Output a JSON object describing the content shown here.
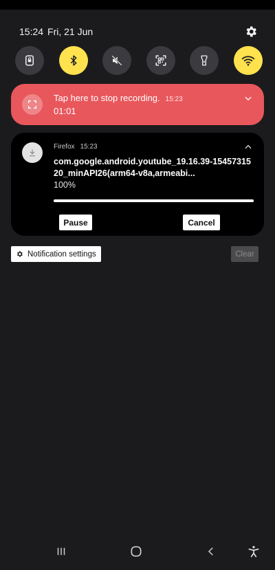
{
  "status": {
    "time": "15:24",
    "date": "Fri, 21 Jun"
  },
  "quick_settings": [
    {
      "name": "lock-screen-icon",
      "on": false
    },
    {
      "name": "bluetooth-icon",
      "on": true
    },
    {
      "name": "mute-icon",
      "on": false
    },
    {
      "name": "qr-scanner-icon",
      "on": false
    },
    {
      "name": "flashlight-icon",
      "on": false
    },
    {
      "name": "wifi-icon",
      "on": true
    }
  ],
  "recording": {
    "title": "Tap here to stop recording.",
    "time": "15:23",
    "elapsed": "01:01"
  },
  "download": {
    "app": "Firefox",
    "time": "15:23",
    "file_name": "com.google.android.youtube_19.16.39-1545731520_minAPI26(arm64-v8a,armeabi...",
    "percent": "100%",
    "progress": 1.0,
    "pause_label": "Pause",
    "cancel_label": "Cancel"
  },
  "footer": {
    "settings_label": "Notification settings",
    "clear_label": "Clear"
  },
  "navigation": [
    "recents-icon",
    "home-icon",
    "back-icon",
    "accessibility-icon"
  ],
  "colors": {
    "accent_yellow": "#ffe24d",
    "recording_red": "#e8575c",
    "panel_bg": "#1b1b1d"
  }
}
